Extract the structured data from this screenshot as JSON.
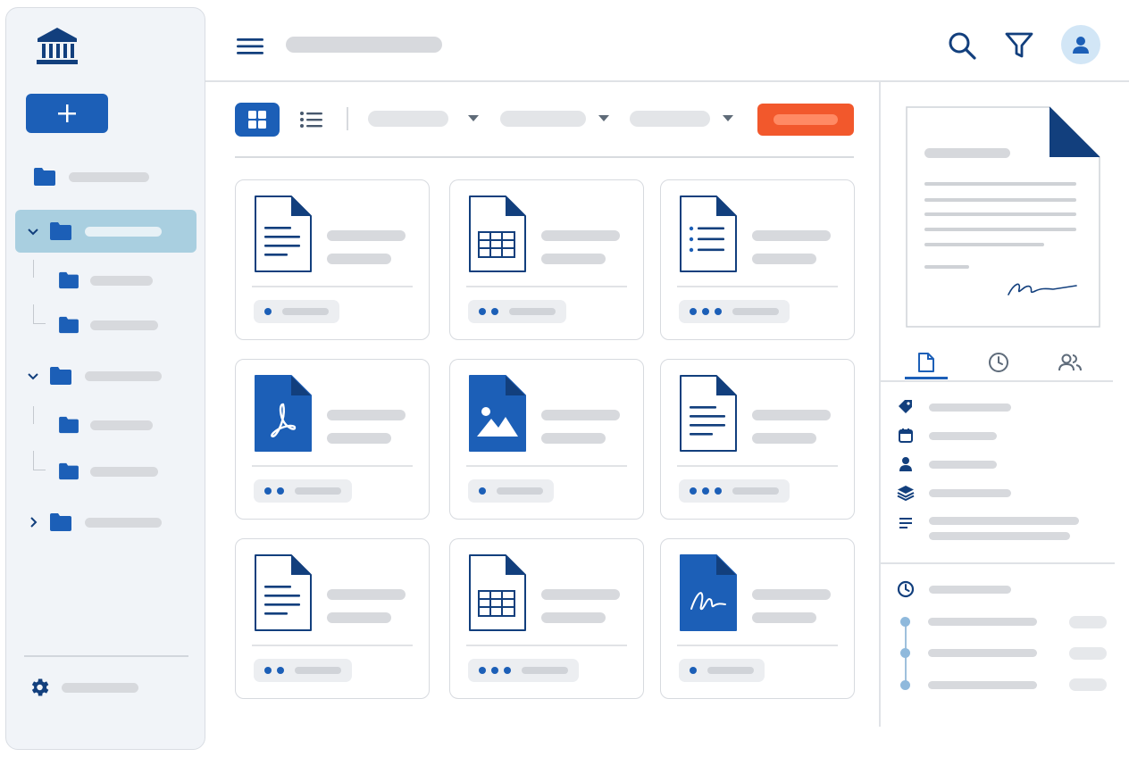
{
  "app": {
    "brand_icon": "bank-building-icon",
    "new_button_icon": "plus-icon",
    "settings_icon": "gear-icon"
  },
  "colors": {
    "primary": "#1c5fb7",
    "accent": "#f2582c",
    "sidebar_bg": "#f1f4f8",
    "active_row": "#a9cfe0",
    "placeholder": "#d7d9dd"
  },
  "sidebar": {
    "tree": [
      {
        "level": 0,
        "expander": "none",
        "selected": false
      },
      {
        "level": 0,
        "expander": "chevron-down-icon",
        "selected": true
      },
      {
        "level": 1,
        "expander": "none",
        "selected": false
      },
      {
        "level": 1,
        "expander": "none",
        "selected": false
      },
      {
        "level": 0,
        "expander": "chevron-down-icon",
        "selected": false
      },
      {
        "level": 1,
        "expander": "none",
        "selected": false
      },
      {
        "level": 1,
        "expander": "none",
        "selected": false
      },
      {
        "level": 0,
        "expander": "chevron-right-icon",
        "selected": false
      }
    ]
  },
  "header": {
    "icons": [
      "menu-icon",
      "search-icon",
      "filter-icon",
      "user-avatar-icon"
    ]
  },
  "toolbar": {
    "view_mode": "grid",
    "view_icons": [
      "grid-view-icon",
      "list-view-icon"
    ],
    "dropdown_count": 3
  },
  "files": [
    {
      "icon": "text-document-icon",
      "filled": false,
      "dots": 1
    },
    {
      "icon": "spreadsheet-icon",
      "filled": false,
      "dots": 2
    },
    {
      "icon": "checklist-document-icon",
      "filled": false,
      "dots": 3
    },
    {
      "icon": "pdf-document-icon",
      "filled": true,
      "dots": 2
    },
    {
      "icon": "image-document-icon",
      "filled": true,
      "dots": 1
    },
    {
      "icon": "text-document-icon",
      "filled": false,
      "dots": 3
    },
    {
      "icon": "text-document-icon",
      "filled": false,
      "dots": 2
    },
    {
      "icon": "spreadsheet-icon",
      "filled": false,
      "dots": 3
    },
    {
      "icon": "signed-document-icon",
      "filled": true,
      "dots": 1
    }
  ],
  "details_panel": {
    "preview_icon": "signed-letter-preview",
    "tabs": [
      {
        "icon": "document-tab-icon",
        "active": true
      },
      {
        "icon": "history-tab-icon",
        "active": false
      },
      {
        "icon": "people-tab-icon",
        "active": false
      }
    ],
    "metadata_icons": [
      "tag-icon",
      "calendar-icon",
      "person-icon",
      "layers-icon",
      "description-icon"
    ],
    "history_icon": "clock-icon",
    "history_entries": 3
  }
}
